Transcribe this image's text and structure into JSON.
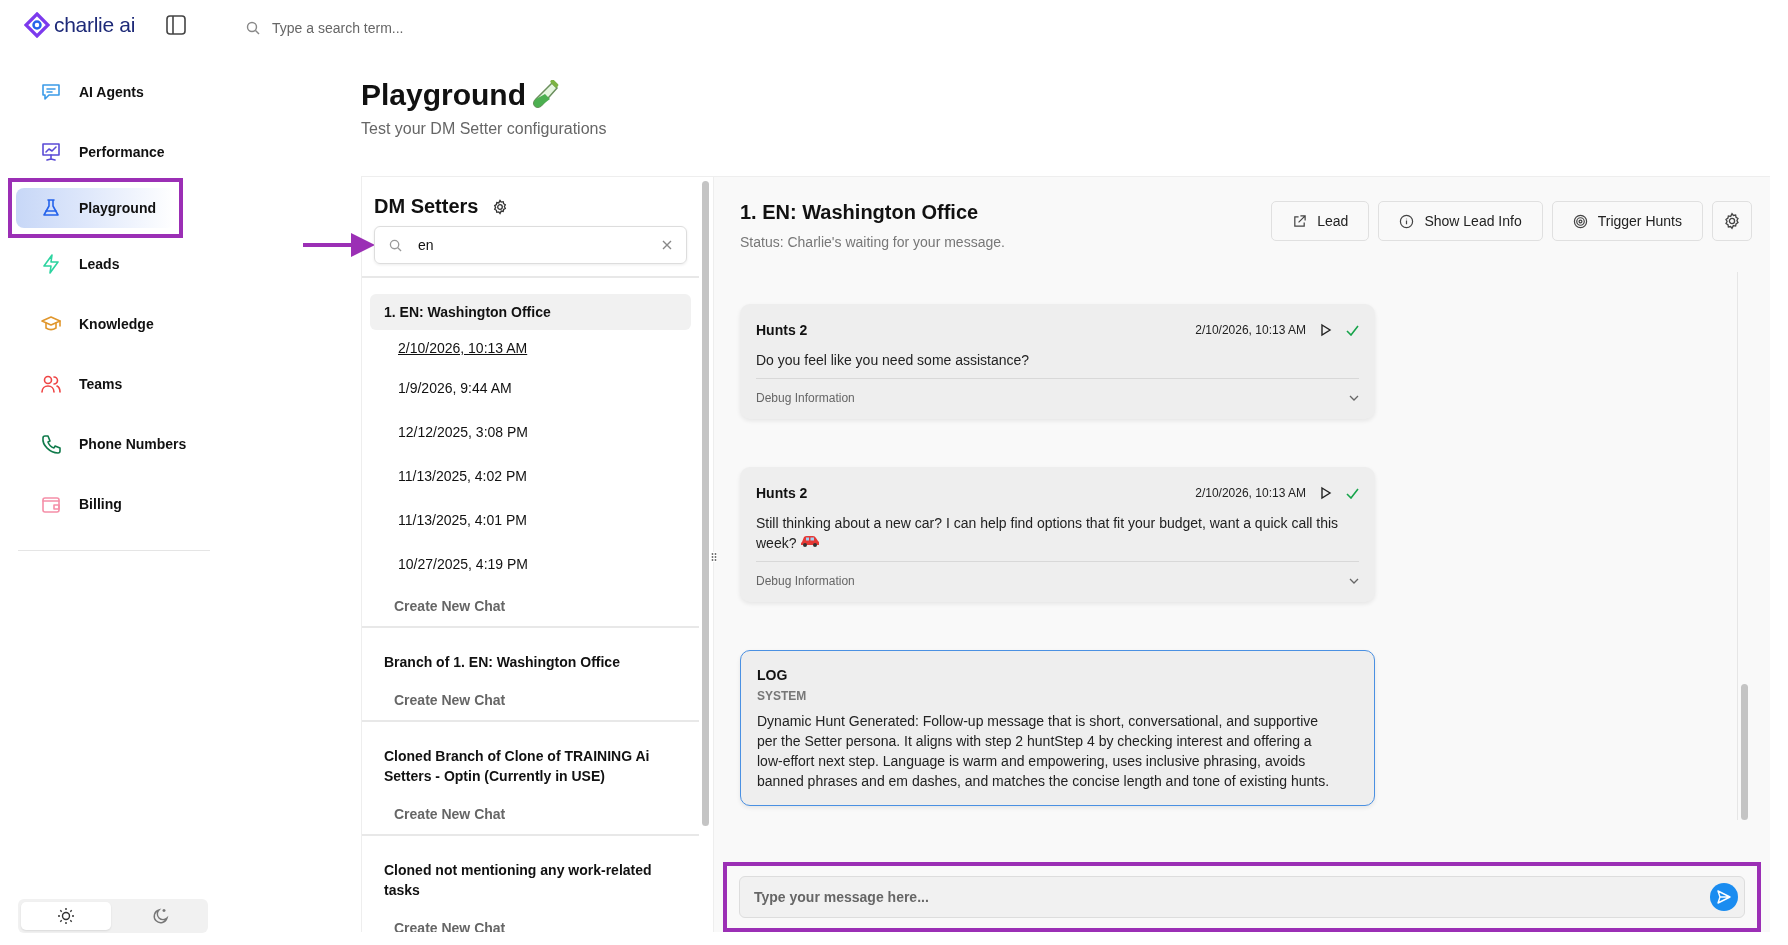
{
  "brand": {
    "name": "charlie ai"
  },
  "search": {
    "placeholder": "Type a search term..."
  },
  "nav": [
    {
      "label": "AI Agents",
      "selected": false,
      "highlighted": false
    },
    {
      "label": "Performance",
      "selected": false,
      "highlighted": false
    },
    {
      "label": "Playground",
      "selected": true,
      "highlighted": true
    },
    {
      "label": "Leads",
      "selected": false,
      "highlighted": false
    },
    {
      "label": "Knowledge",
      "selected": false,
      "highlighted": false
    },
    {
      "label": "Teams",
      "selected": false,
      "highlighted": false
    },
    {
      "label": "Phone Numbers",
      "selected": false,
      "highlighted": false
    },
    {
      "label": "Billing",
      "selected": false,
      "highlighted": false
    }
  ],
  "theme": [
    {
      "selected": true
    },
    {
      "selected": false
    }
  ],
  "page": {
    "title": "Playground",
    "subtitle": "Test your DM Setter configurations"
  },
  "setters": {
    "title": "DM Setters",
    "search_value": "en",
    "search_highlighted": true,
    "groups": [
      {
        "name": "1. EN: Washington Office",
        "selected": true,
        "chats": [
          {
            "label": "2/10/2026, 10:13 AM",
            "selected": true
          },
          {
            "label": "1/9/2026, 9:44 AM",
            "selected": false
          },
          {
            "label": "12/12/2025, 3:08 PM",
            "selected": false
          },
          {
            "label": "11/13/2025, 4:02 PM",
            "selected": false
          },
          {
            "label": "11/13/2025, 4:01 PM",
            "selected": false
          },
          {
            "label": "10/27/2025, 4:19 PM",
            "selected": false
          }
        ],
        "create": "Create New Chat"
      },
      {
        "name": "Branch of 1. EN: Washington Office",
        "selected": false,
        "create": "Create New Chat"
      },
      {
        "name": "Cloned Branch of Clone of TRAINING Ai Setters - Optin (Currently in USE)",
        "selected": false,
        "create": "Create New Chat"
      },
      {
        "name": "Cloned not mentioning any work-related tasks",
        "selected": false,
        "create": "Create New Chat"
      }
    ]
  },
  "chat": {
    "title": "1. EN: Washington Office",
    "status": "Status: Charlie's waiting for your message.",
    "buttons": [
      {
        "label": "Lead"
      },
      {
        "label": "Show Lead Info"
      },
      {
        "label": "Trigger Hunts"
      }
    ],
    "messages": [
      {
        "kind": "hunt",
        "sender": "Hunts 2",
        "time": "2/10/2026, 10:13 AM",
        "text": "Do you feel like you need some assistance?",
        "debug": "Debug Information",
        "delivered": true
      },
      {
        "kind": "hunt",
        "sender": "Hunts 2",
        "time": "2/10/2026, 10:13 AM",
        "text": "Still thinking about a new car? I can help find options that fit your budget, want a quick call this week?",
        "debug": "Debug Information",
        "delivered": true
      },
      {
        "kind": "log",
        "title": "LOG",
        "role": "SYSTEM",
        "text": "Dynamic Hunt Generated: Follow-up message that is short, conversational, and supportive per the Setter persona. It aligns with step 2 huntStep 4 by checking interest and offering a low-effort next step. Language is warm and empowering, uses inclusive phrasing, avoids banned phrases and em dashes, and matches the concise length and tone of existing hunts."
      }
    ],
    "composer": {
      "placeholder": "Type your message here...",
      "highlighted": true
    }
  }
}
